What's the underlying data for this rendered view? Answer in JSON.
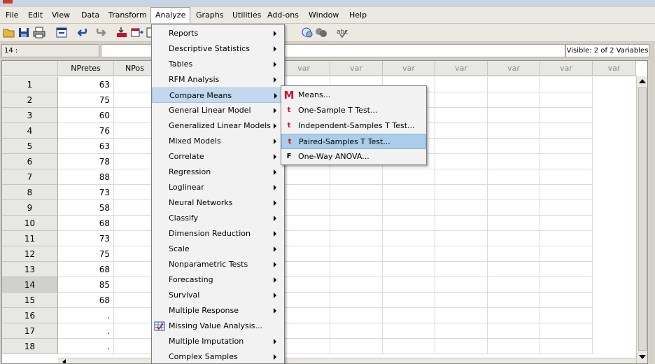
{
  "menubar": {
    "items": [
      "File",
      "Edit",
      "View",
      "Data",
      "Transform",
      "Analyze",
      "Graphs",
      "Utilities",
      "Add-ons",
      "Window",
      "Help"
    ]
  },
  "cellbar": {
    "cell_ref": "14 :",
    "visible_vars": "Visible: 2 of 2 Variables"
  },
  "grid": {
    "columns": [
      "NPretes",
      "NPos",
      "var",
      "var",
      "var",
      "var",
      "var",
      "var",
      "var"
    ],
    "rows": [
      {
        "n": "1",
        "v": "63"
      },
      {
        "n": "2",
        "v": "75"
      },
      {
        "n": "3",
        "v": "60"
      },
      {
        "n": "4",
        "v": "76"
      },
      {
        "n": "5",
        "v": "63"
      },
      {
        "n": "6",
        "v": "78"
      },
      {
        "n": "7",
        "v": "88"
      },
      {
        "n": "8",
        "v": "73"
      },
      {
        "n": "9",
        "v": "58"
      },
      {
        "n": "10",
        "v": "68"
      },
      {
        "n": "11",
        "v": "73"
      },
      {
        "n": "12",
        "v": "75"
      },
      {
        "n": "13",
        "v": "68"
      },
      {
        "n": "14",
        "v": "85"
      },
      {
        "n": "15",
        "v": "68"
      },
      {
        "n": "16",
        "v": "."
      },
      {
        "n": "17",
        "v": "."
      },
      {
        "n": "18",
        "v": "."
      }
    ]
  },
  "analyze_menu": {
    "items": [
      {
        "label": "Reports",
        "submenu": true
      },
      {
        "label": "Descriptive Statistics",
        "submenu": true
      },
      {
        "label": "Tables",
        "submenu": true
      },
      {
        "label": "RFM Analysis",
        "submenu": true
      },
      {
        "label": "Compare Means",
        "submenu": true
      },
      {
        "label": "General Linear Model",
        "submenu": true
      },
      {
        "label": "Generalized Linear Models",
        "submenu": true
      },
      {
        "label": "Mixed Models",
        "submenu": true
      },
      {
        "label": "Correlate",
        "submenu": true
      },
      {
        "label": "Regression",
        "submenu": true
      },
      {
        "label": "Loglinear",
        "submenu": true
      },
      {
        "label": "Neural Networks",
        "submenu": true
      },
      {
        "label": "Classify",
        "submenu": true
      },
      {
        "label": "Dimension Reduction",
        "submenu": true
      },
      {
        "label": "Scale",
        "submenu": true
      },
      {
        "label": "Nonparametric Tests",
        "submenu": true
      },
      {
        "label": "Forecasting",
        "submenu": true
      },
      {
        "label": "Survival",
        "submenu": true
      },
      {
        "label": "Multiple Response",
        "submenu": true
      },
      {
        "label": "Missing Value Analysis...",
        "submenu": false,
        "icon": "missing-value-icon"
      },
      {
        "label": "Multiple Imputation",
        "submenu": true
      },
      {
        "label": "Complex Samples",
        "submenu": true
      }
    ]
  },
  "compare_means_menu": {
    "items": [
      {
        "label": "Means...",
        "icon": "means-icon",
        "glyph": "M"
      },
      {
        "label": "One-Sample T Test...",
        "icon": "one-sample-t-icon",
        "glyph": "t"
      },
      {
        "label": "Independent-Samples T Test...",
        "icon": "independent-t-icon",
        "glyph": "t"
      },
      {
        "label": "Paired-Samples T Test...",
        "icon": "paired-t-icon",
        "glyph": "t"
      },
      {
        "label": "One-Way ANOVA...",
        "icon": "anova-icon",
        "glyph": "F"
      }
    ]
  },
  "colors": {
    "accent_red": "#c8102e",
    "highlight": "#c1d8ef"
  }
}
